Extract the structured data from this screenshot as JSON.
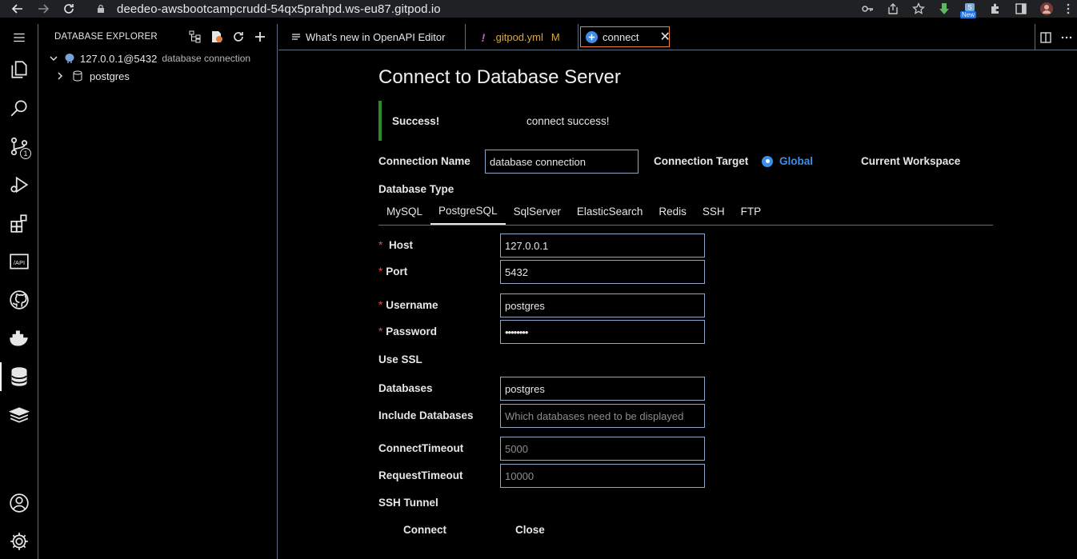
{
  "browser": {
    "url": "deedeo-awsbootcampcrudd-54qx5prahpd.ws-eu87.gitpod.io",
    "extension_badge": "New"
  },
  "activity_bar": {
    "scm_count": "1"
  },
  "sidebar": {
    "title": "DATABASE EXPLORER",
    "connection_label": "127.0.0.1@5432",
    "connection_desc": "database connection",
    "child_label": "postgres"
  },
  "tabs": [
    {
      "label": "What's new in OpenAPI Editor"
    },
    {
      "label": ".gitpod.yml",
      "badge": "M"
    },
    {
      "label": "connect"
    }
  ],
  "form": {
    "title": "Connect to Database Server",
    "alert_title": "Success!",
    "alert_message": "connect success!",
    "connection_name_label": "Connection Name",
    "connection_name_value": "database connection",
    "connection_target_label": "Connection Target",
    "target_global": "Global",
    "target_workspace": "Current Workspace",
    "db_type_label": "Database Type",
    "db_types": [
      "MySQL",
      "PostgreSQL",
      "SqlServer",
      "ElasticSearch",
      "Redis",
      "SSH",
      "FTP"
    ],
    "host_label": "Host",
    "host_value": "127.0.0.1",
    "port_label": "Port",
    "port_value": "5432",
    "username_label": "Username",
    "username_value": "postgres",
    "password_label": "Password",
    "password_value": "••••••••",
    "use_ssl_label": "Use SSL",
    "databases_label": "Databases",
    "databases_value": "postgres",
    "include_databases_label": "Include Databases",
    "include_databases_placeholder": "Which databases need to be displayed",
    "connect_timeout_label": "ConnectTimeout",
    "connect_timeout_placeholder": "5000",
    "request_timeout_label": "RequestTimeout",
    "request_timeout_placeholder": "10000",
    "ssh_tunnel_label": "SSH Tunnel",
    "connect_button": "Connect",
    "close_button": "Close"
  },
  "colors": {
    "accent": "#3b8eea",
    "success_bar": "#2d8a2d",
    "active_tab_border": "#f08040",
    "required": "#e05050"
  }
}
